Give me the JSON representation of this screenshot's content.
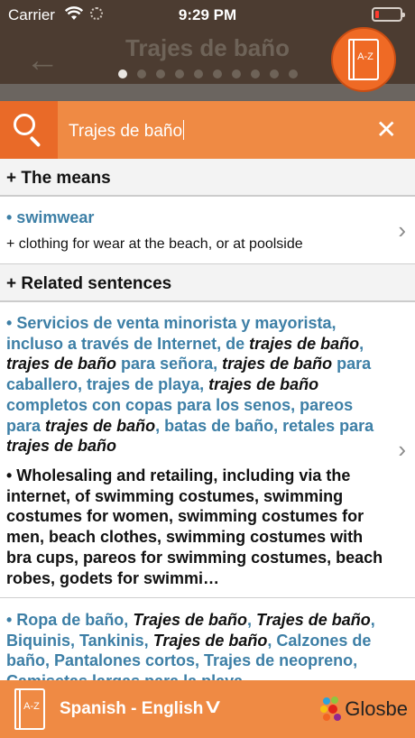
{
  "status_bar": {
    "carrier": "Carrier",
    "time": "9:29 PM",
    "battery_level": 0.1
  },
  "header": {
    "title": "Trajes de baño",
    "page_dots": 10,
    "active_dot": 0,
    "az_label": "A-Z"
  },
  "search": {
    "query": "Trajes de baño"
  },
  "means": {
    "heading": "+ The means",
    "term": "• swimwear",
    "definition": "+ clothing for wear at the beach, or at poolside"
  },
  "related": {
    "heading": "+ Related sentences"
  },
  "sentence1": {
    "bullet": "• ",
    "p1": "Servicios de venta minorista y mayorista, incluso a través de Internet, de ",
    "e1": "trajes de baño",
    "p2": ", ",
    "e2": "trajes de baño",
    "p3": " para señora, ",
    "e3": "trajes de baño",
    "p4": " para caballero, trajes de playa, ",
    "e4": "trajes de baño",
    "p5": " completos con copas para los senos, pareos para ",
    "e5": "trajes de baño",
    "p6": ", batas de baño, retales para ",
    "e6": "trajes de baño",
    "translation": "• Wholesaling and retailing, including via the internet, of swimming costumes, swimming costumes for women, swimming costumes for men, beach clothes, swimming costumes with bra cups, pareos for swimming costumes, beach robes, godets for swimmi…"
  },
  "sentence2": {
    "p1": "• Ropa de baño, ",
    "e1": "Trajes de baño",
    "p2": ", ",
    "e2": "Trajes de baño",
    "p3": ", Biquinis, Tankinis, ",
    "e3": "Trajes de baño",
    "p4": ", Calzones de baño, Pantalones cortos, Trajes de neopreno, Camisetas largas para la playa"
  },
  "bottom_bar": {
    "language_pair": "Spanish - English",
    "book_label": "A-Z",
    "logo_text": "Glosbe"
  },
  "colors": {
    "accent": "#ef8a44",
    "header_bg": "#4c3c31",
    "link": "#3d7fa6"
  }
}
